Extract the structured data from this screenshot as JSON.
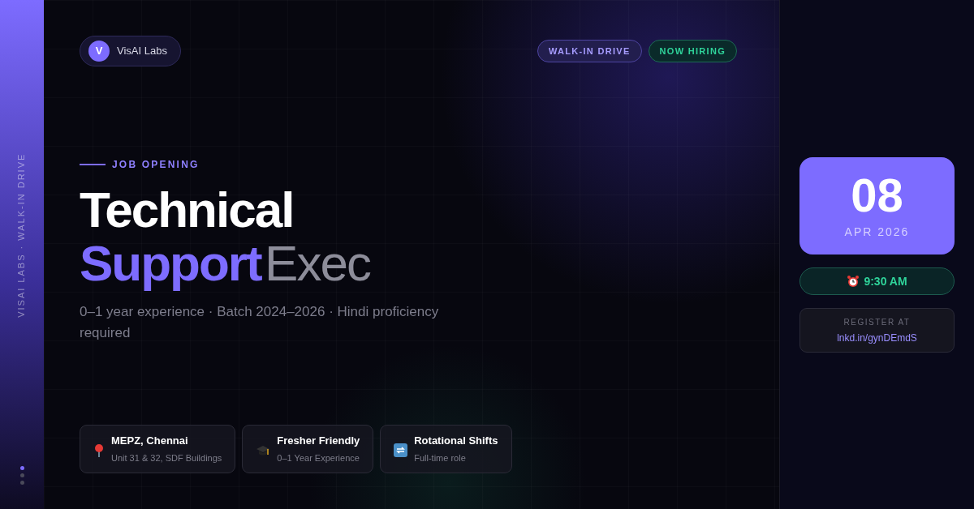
{
  "sidebar": {
    "vertical_text": "VISAI LABS · WALK-IN DRIVE",
    "dots": [
      {
        "selected": true
      },
      {
        "selected": false
      },
      {
        "selected": false
      }
    ]
  },
  "brand": {
    "initial": "V",
    "name": "VisAI Labs"
  },
  "badges": [
    {
      "label": "WALK-IN DRIVE",
      "kind": "purple"
    },
    {
      "label": "NOW HIRING",
      "kind": "green"
    }
  ],
  "eyebrow": "JOB OPENING",
  "title": {
    "line1": "Technical",
    "highlight": "Support",
    "rest": "Exec"
  },
  "subtitle": "0–1 year experience · Batch 2024–2026 · Hindi proficiency required",
  "features": [
    {
      "kind": "pin",
      "title": "MEPZ, Chennai",
      "detail": "Unit 31 & 32, SDF Buildings"
    },
    {
      "kind": "cap",
      "title": "Fresher Friendly",
      "detail": "0–1 Year Experience"
    },
    {
      "kind": "shift",
      "title": "Rotational Shifts",
      "detail": "Full-time role"
    }
  ],
  "date": {
    "day": "08",
    "month_year": "APR 2026"
  },
  "time": "9:30 AM",
  "register": {
    "label": "REGISTER AT",
    "link": "lnkd.in/gynDEmdS"
  }
}
